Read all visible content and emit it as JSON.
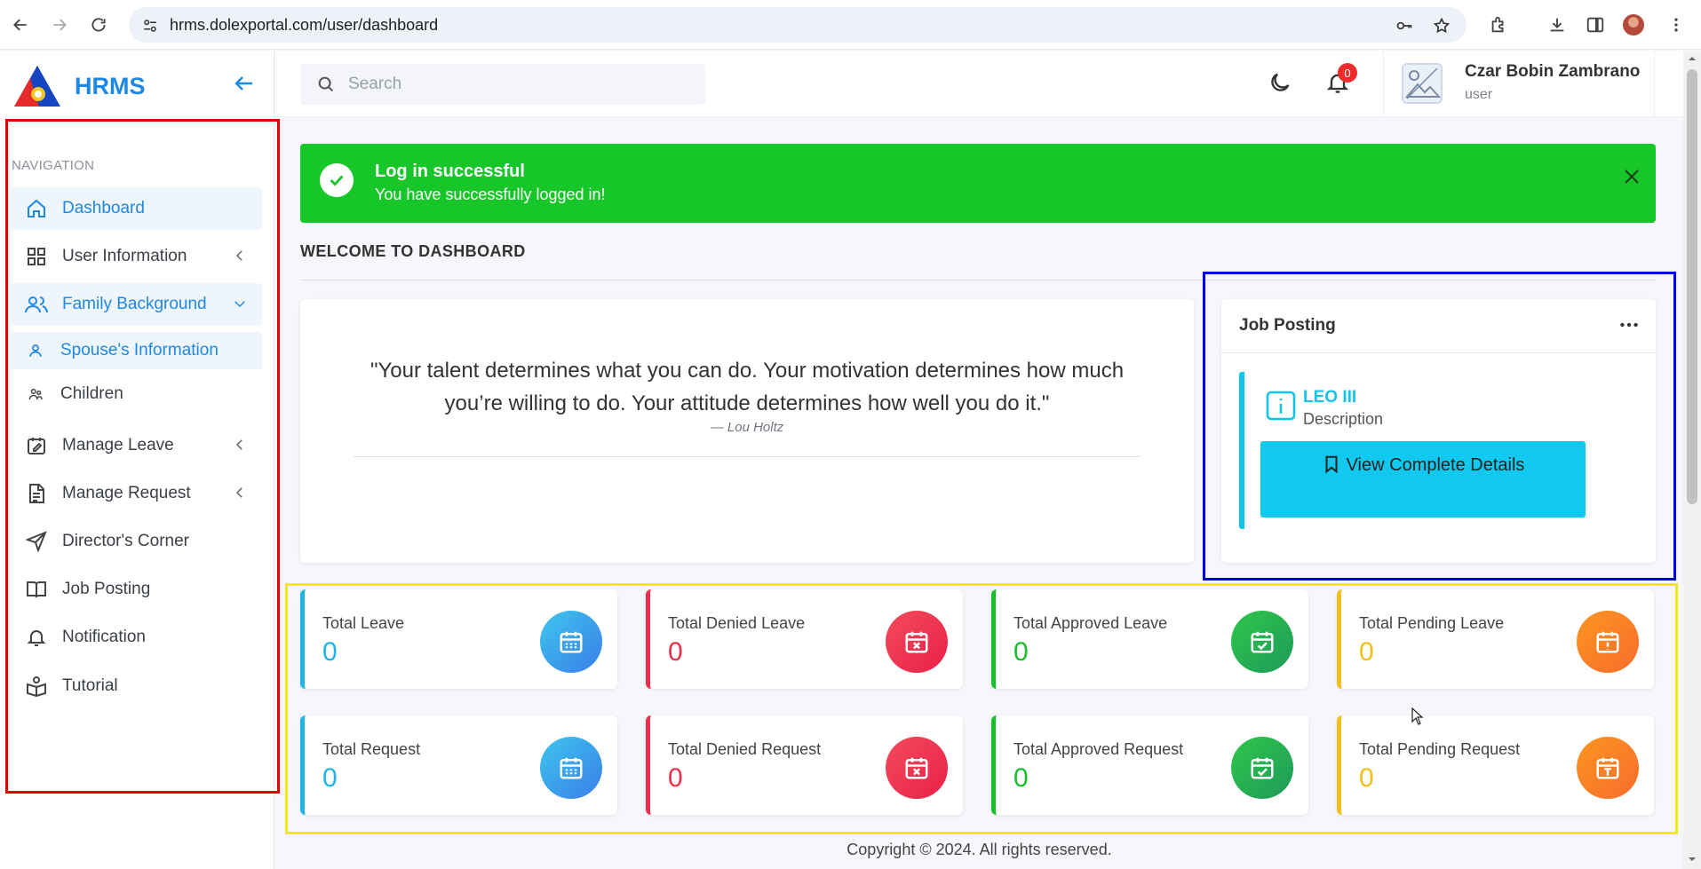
{
  "browser": {
    "url": "hrms.dolexportal.com/user/dashboard"
  },
  "brand": {
    "name": "HRMS"
  },
  "sidebar": {
    "heading": "NAVIGATION",
    "items": [
      {
        "label": "Dashboard",
        "icon": "home-icon",
        "active": true
      },
      {
        "label": "User Information",
        "icon": "grid-icon"
      },
      {
        "label": "Family Background",
        "icon": "users-icon",
        "active": true
      },
      {
        "label": "Spouse's Information",
        "icon": "user-icon",
        "active": true
      },
      {
        "label": "Children",
        "icon": "children-icon"
      },
      {
        "label": "Manage Leave",
        "icon": "edit-calendar-icon"
      },
      {
        "label": "Manage Request",
        "icon": "document-icon"
      },
      {
        "label": "Director's Corner",
        "icon": "send-icon"
      },
      {
        "label": "Job Posting",
        "icon": "book-icon"
      },
      {
        "label": "Notification",
        "icon": "bell-icon"
      },
      {
        "label": "Tutorial",
        "icon": "reader-icon"
      }
    ]
  },
  "topbar": {
    "search_placeholder": "Search",
    "notification_count": "0",
    "user_name": "Czar Bobin Zambrano",
    "user_role": "user"
  },
  "alert": {
    "title": "Log in successful",
    "message": "You have successfully logged in!"
  },
  "welcome": "WELCOME TO DASHBOARD",
  "quote": {
    "text": "\"Your talent determines what you can do. Your motivation determines how much you’re willing to do. Your attitude determines how well you do it.\"",
    "author": "— Lou Holtz"
  },
  "job_posting": {
    "title": "Job Posting",
    "item_name": "LEO III",
    "item_desc": "Description",
    "button_label": "View Complete Details"
  },
  "stats": [
    {
      "label": "Total Leave",
      "value": "0",
      "color": "#20b3e6"
    },
    {
      "label": "Total Denied Leave",
      "value": "0",
      "color": "#ea2f4c"
    },
    {
      "label": "Total Approved Leave",
      "value": "0",
      "color": "#16c02a"
    },
    {
      "label": "Total Pending Leave",
      "value": "0",
      "color": "#f2c01c"
    },
    {
      "label": "Total Request",
      "value": "0",
      "color": "#20b3e6"
    },
    {
      "label": "Total Denied Request",
      "value": "0",
      "color": "#ea2f4c"
    },
    {
      "label": "Total Approved Request",
      "value": "0",
      "color": "#16c02a"
    },
    {
      "label": "Total Pending Request",
      "value": "0",
      "color": "#f2c01c"
    }
  ],
  "footer": "Copyright © 2024. All rights reserved.",
  "colors": {
    "primary": "#1e88e5",
    "success": "#17c729",
    "info": "#11c4e9",
    "danger": "#ea2f4c",
    "warning": "#f2c01c"
  }
}
